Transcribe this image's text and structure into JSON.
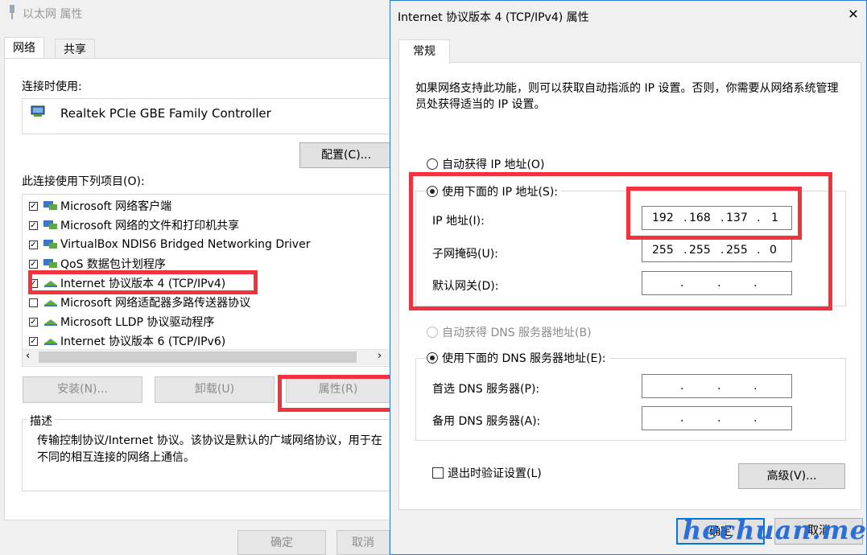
{
  "left_dialog": {
    "title": "以太网 属性",
    "tabs": [
      "网络",
      "共享"
    ],
    "connect_using_label": "连接时使用:",
    "adapter_name": "Realtek PCIe GBE Family Controller",
    "configure_button": "配置(C)...",
    "items_label": "此连接使用下列项目(O):",
    "items": [
      {
        "label": "Microsoft 网络客户端",
        "checked": true
      },
      {
        "label": "Microsoft 网络的文件和打印机共享",
        "checked": true
      },
      {
        "label": "VirtualBox NDIS6 Bridged Networking Driver",
        "checked": true
      },
      {
        "label": "QoS 数据包计划程序",
        "checked": true
      },
      {
        "label": "Internet 协议版本 4 (TCP/IPv4)",
        "checked": true
      },
      {
        "label": "Microsoft 网络适配器多路传送器协议",
        "checked": false
      },
      {
        "label": "Microsoft LLDP 协议驱动程序",
        "checked": true
      },
      {
        "label": "Internet 协议版本 6 (TCP/IPv6)",
        "checked": true
      }
    ],
    "install_button": "安装(N)...",
    "uninstall_button": "卸载(U)",
    "properties_button": "属性(R)",
    "description_legend": "描述",
    "description_text": "传输控制协议/Internet 协议。该协议是默认的广域网络协议，用于在不同的相互连接的网络上通信。",
    "ok_button": "确定",
    "cancel_button": "取消"
  },
  "right_dialog": {
    "title": "Internet 协议版本 4 (TCP/IPv4) 属性",
    "close_glyph": "✕",
    "tab": "常规",
    "intro": "如果网络支持此功能，则可以获取自动指派的 IP 设置。否则，你需要从网络系统管理员处获得适当的 IP 设置。",
    "auto_ip_label": "自动获得 IP 地址(O)",
    "manual_ip_label": "使用下面的 IP 地址(S):",
    "ip_address_label": "IP 地址(I):",
    "ip_address": [
      "192",
      "168",
      "137",
      "1"
    ],
    "subnet_label": "子网掩码(U):",
    "subnet": [
      "255",
      "255",
      "255",
      "0"
    ],
    "gateway_label": "默认网关(D):",
    "auto_dns_label": "自动获得 DNS 服务器地址(B)",
    "manual_dns_label": "使用下面的 DNS 服务器地址(E):",
    "preferred_dns_label": "首选 DNS 服务器(P):",
    "alternate_dns_label": "备用 DNS 服务器(A):",
    "validate_label": "退出时验证设置(L)",
    "advanced_button": "高级(V)...",
    "ok_button": "确定",
    "cancel_button": "取消"
  },
  "watermark": "hechuan.me",
  "colors": {
    "highlight": "#f2323c",
    "accent": "#2b7bd6"
  }
}
